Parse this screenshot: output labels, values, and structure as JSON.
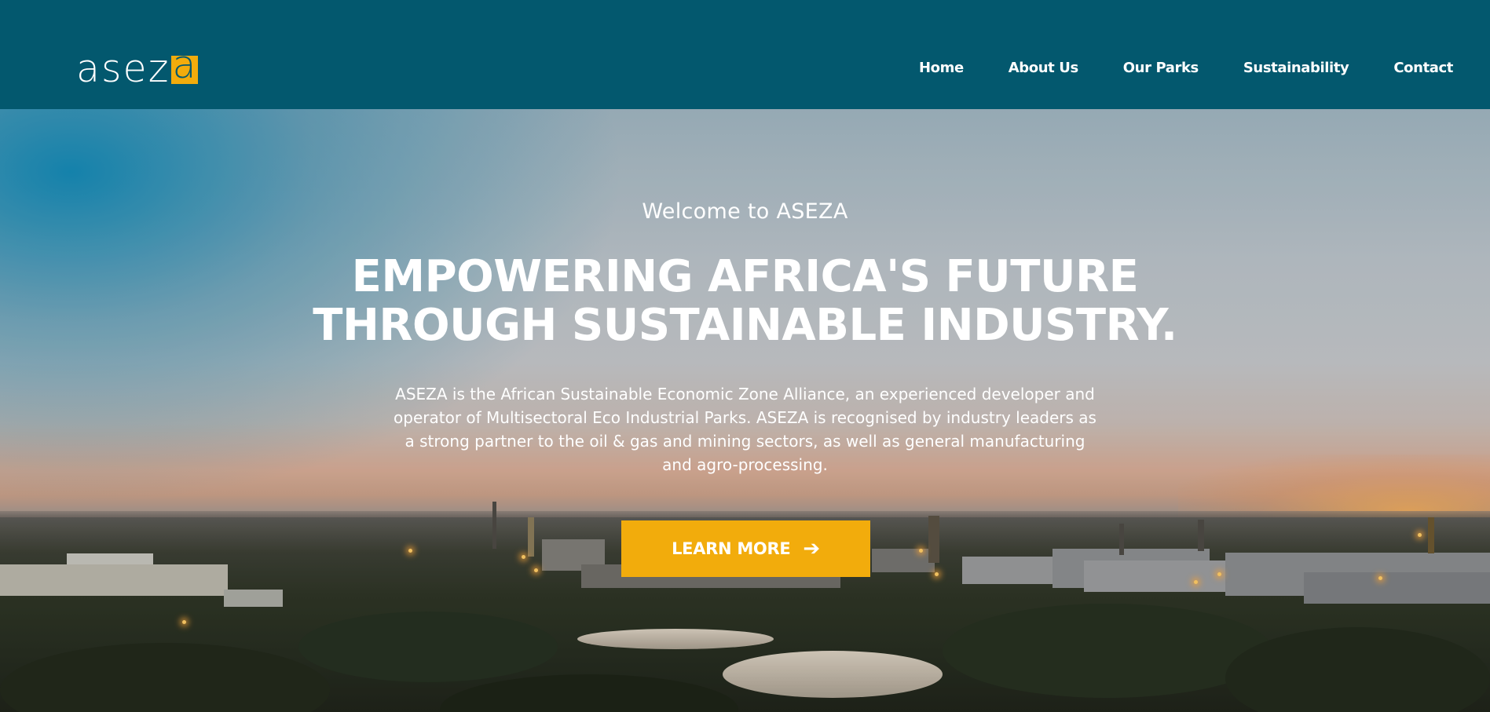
{
  "header": {
    "logo": {
      "text": "asez",
      "box_letter": "a"
    },
    "nav": [
      {
        "label": "Home"
      },
      {
        "label": "About Us"
      },
      {
        "label": "Our Parks"
      },
      {
        "label": "Sustainability"
      },
      {
        "label": "Contact"
      }
    ]
  },
  "hero": {
    "welcome": "Welcome to ASEZA",
    "headline_line1": "EMPOWERING AFRICA'S FUTURE",
    "headline_line2": "THROUGH SUSTAINABLE INDUSTRY.",
    "description": "ASEZA is the African Sustainable Economic Zone Alliance, an experienced developer and operator of Multisectoral Eco Industrial Parks. ASEZA is recognised by industry leaders as a strong partner to the oil & gas and mining sectors, as well as general manufacturing and agro-processing.",
    "cta_label": "LEARN MORE",
    "cta_icon": "arrow-right-icon",
    "background_image": "industrial-park-at-dusk"
  },
  "colors": {
    "header_bg": "#03586e",
    "accent": "#f2ac0c",
    "text": "#ffffff"
  }
}
